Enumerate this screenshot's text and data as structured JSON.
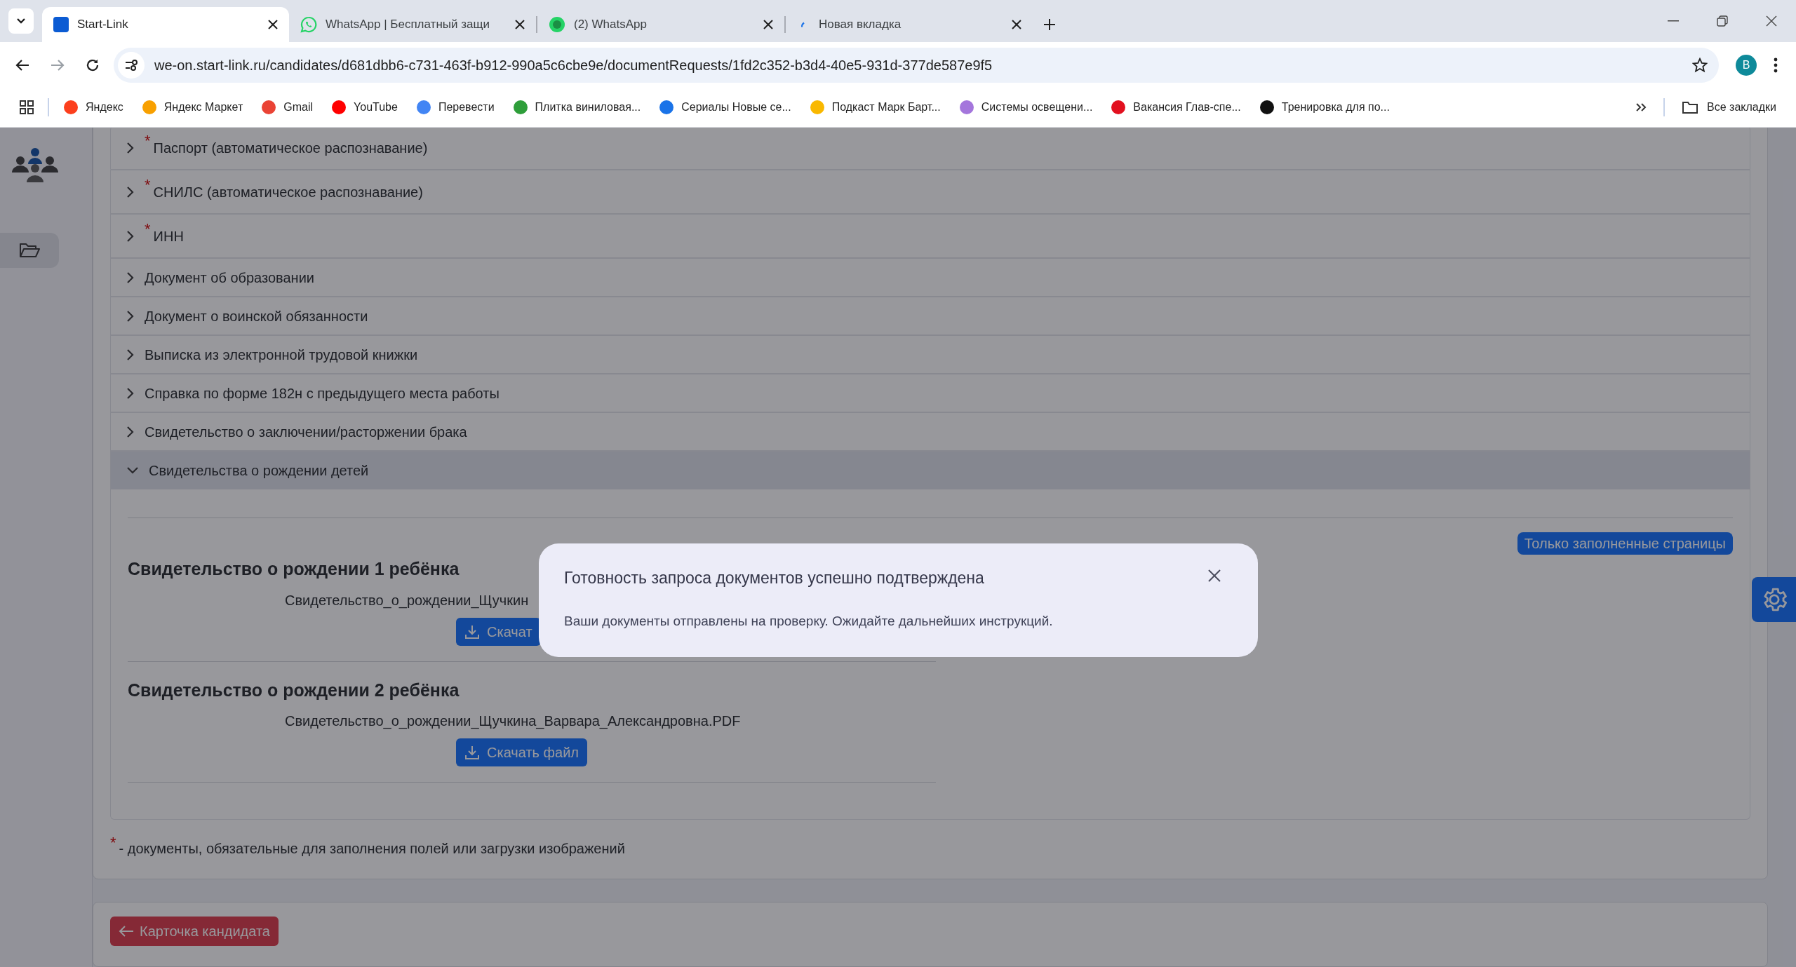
{
  "browser": {
    "tabs": [
      {
        "title": "Start-Link",
        "selected": true
      },
      {
        "title": "WhatsApp | Бесплатный защи",
        "selected": false
      },
      {
        "title": "(2) WhatsApp",
        "selected": false
      },
      {
        "title": "Новая вкладка",
        "selected": false
      }
    ],
    "address": "we-on.start-link.ru/candidates/d681dbb6-c731-463f-b912-990a5c6cbe9e/documentRequests/1fd2c352-b3d4-40e5-931d-377de587e9f5",
    "profile": "B",
    "bookmarks": [
      {
        "label": "Яндекс",
        "color": "#fc3f1d"
      },
      {
        "label": "Яндекс Маркет",
        "color": "#f8a000"
      },
      {
        "label": "Gmail",
        "color": "#ea4335"
      },
      {
        "label": "YouTube",
        "color": "#ff0000"
      },
      {
        "label": "Перевести",
        "color": "#4285f4"
      },
      {
        "label": "Плитка виниловая...",
        "color": "#2e9e3a"
      },
      {
        "label": "Сериалы Новые се...",
        "color": "#1a73e8"
      },
      {
        "label": "Подкаст Марк Барт...",
        "color": "#f9b800"
      },
      {
        "label": "Системы освещени...",
        "color": "#a476dc"
      },
      {
        "label": "Вакансия Глав-спе...",
        "color": "#e2101f"
      },
      {
        "label": "Тренировка для по...",
        "color": "#111111"
      }
    ],
    "all_bookmarks": "Все закладки"
  },
  "accordion": [
    {
      "label": "Паспорт (автоматическое распознавание)",
      "required": true,
      "expanded": false
    },
    {
      "label": "СНИЛС (автоматическое распознавание)",
      "required": true,
      "expanded": false
    },
    {
      "label": "ИНН",
      "required": true,
      "expanded": false
    },
    {
      "label": "Документ об образовании",
      "required": false,
      "expanded": false
    },
    {
      "label": "Документ о воинской обязанности",
      "required": false,
      "expanded": false
    },
    {
      "label": "Выписка из электронной трудовой книжки",
      "required": false,
      "expanded": false
    },
    {
      "label": "Справка по форме 182н с предыдущего места работы",
      "required": false,
      "expanded": false
    },
    {
      "label": "Свидетельство о заключении/расторжении брака",
      "required": false,
      "expanded": false
    },
    {
      "label": "Свидетельства о рождении детей",
      "required": false,
      "expanded": true
    }
  ],
  "filled_only_button": "Только заполненные страницы",
  "certificates": [
    {
      "title": "Свидетельство о рождении 1 ребёнка",
      "file": "Свидетельство_о_рождении_Щучкин",
      "button": "Скачат"
    },
    {
      "title": "Свидетельство о рождении 2 ребёнка",
      "file": "Свидетельство_о_рождении_Щучкина_Варвара_Александровна.PDF",
      "button": "Скачать файл"
    }
  ],
  "footnote": {
    "mark": "*",
    "text": "- документы, обязательные для заполнения полей или загрузки изображений"
  },
  "back_button": "Карточка кандидата",
  "modal": {
    "title": "Готовность запроса документов успешно подтверждена",
    "body": "Ваши документы отправлены на проверку. Ожидайте дальнейших инструкций."
  }
}
